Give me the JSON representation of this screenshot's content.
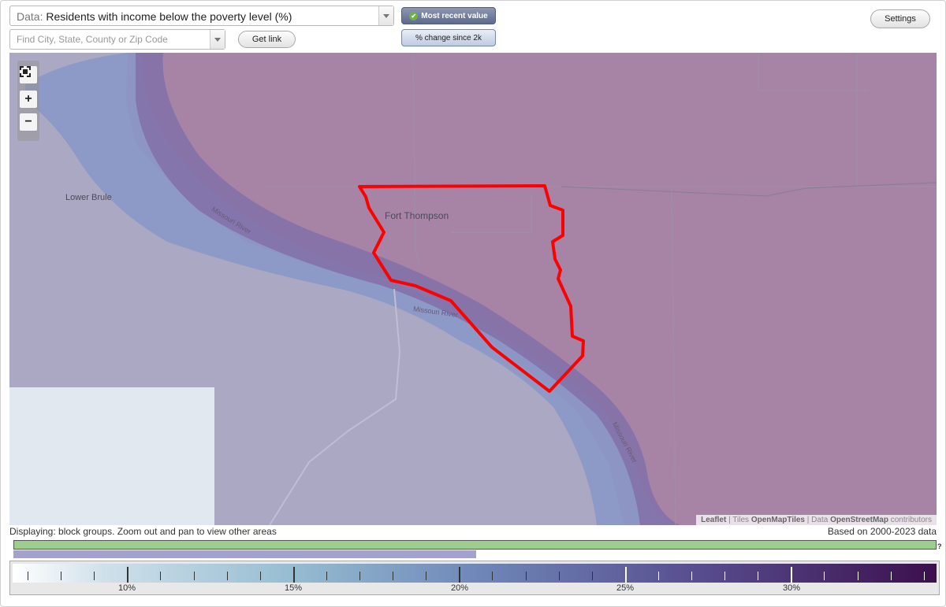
{
  "header": {
    "data_prefix": "Data:",
    "data_label": "Residents with income below the poverty level (%)",
    "search_placeholder": "Find City, State, County or Zip Code",
    "get_link": "Get link",
    "toggle_active": "Most recent value",
    "toggle_inactive": "% change since 2k",
    "settings": "Settings"
  },
  "map": {
    "zoom_in": "+",
    "zoom_out": "−",
    "labels": {
      "lower_brule": "Lower Brule",
      "fort_thompson": "Fort Thompson",
      "river_1": "Missouri River",
      "river_2": "Missouri River",
      "river_3": "Missouri River"
    },
    "attribution": {
      "leaflet": "Leaflet",
      "sep1": " | Tiles ",
      "tiles": "OpenMapTiles",
      "sep2": " | Data ",
      "osm": "OpenStreetMap",
      "contrib": " contributors"
    },
    "colors": {
      "highlight": "#ff0000",
      "land_east": "#a784a6",
      "land_west": "#aba8c3",
      "river": "#8a97c6"
    }
  },
  "footer": {
    "displaying": "Displaying: block groups. Zoom out and pan to view other areas",
    "based_on": "Based on 2000-2023 data",
    "question": "?",
    "legend_labels": [
      "10%",
      "15%",
      "20%",
      "25%",
      "30%"
    ]
  }
}
